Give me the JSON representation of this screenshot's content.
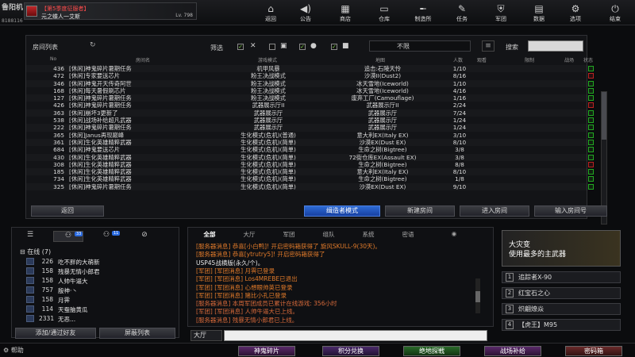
{
  "top": {
    "corner_logo": "鲁阳机",
    "user_id": "8188116",
    "season_badge": "【第5季度征服者】",
    "player_name": "元之蝶人一艾斯",
    "level": "Lv. 798",
    "nav": [
      "返回",
      "公告",
      "商店",
      "仓库",
      "制造所",
      "任务",
      "军团",
      "数据",
      "选项",
      "结束"
    ]
  },
  "room_list": {
    "title": "房间列表",
    "filter_label": "筛选",
    "mode_value": "不限",
    "search_label": "搜索",
    "search_value": "",
    "headers": [
      "No",
      "房间名",
      "游戏模式",
      "地图",
      "人数",
      "观看",
      "限制",
      "战场",
      "状态"
    ],
    "rows": [
      {
        "no": "436",
        "name": "[休闲]神鬼碎片暑期任务",
        "mode": "机甲风暴",
        "map": "追击:石陵天怜",
        "count": "1/10",
        "status": "green"
      },
      {
        "no": "472",
        "name": "[休闲]专家要送芯片",
        "mode": "粉王决战模式",
        "map": "沙漠II(Dust2)",
        "count": "8/16",
        "status": "red"
      },
      {
        "no": "346",
        "name": "[休闲]神鬼开天传奇阿世",
        "mode": "粉王决战模式",
        "map": "冰天雪地(Iceworld)",
        "count": "1/10",
        "status": "green"
      },
      {
        "no": "168",
        "name": "[休闲]每天暑假刷芯片",
        "mode": "粉王决战模式",
        "map": "冰天雪地(Iceworld)",
        "count": "4/16",
        "status": "green"
      },
      {
        "no": "127",
        "name": "[休闲]神鬼碎片暑期任务",
        "mode": "粉王决战模式",
        "map": "废弃工厂(Camouflage)",
        "count": "1/16",
        "status": "green"
      },
      {
        "no": "426",
        "name": "[休闲]神鬼碎片暑期任务",
        "mode": "武器展示厅II",
        "map": "武器展示厅II",
        "count": "2/24",
        "status": "red"
      },
      {
        "no": "363",
        "name": "[休闲]崩坏3更新了",
        "mode": "武器展示厅",
        "map": "武器展示厅",
        "count": "7/24",
        "status": "green"
      },
      {
        "no": "538",
        "name": "[休闲]战场补给超凡武器",
        "mode": "武器展示厅",
        "map": "武器展示厅",
        "count": "1/24",
        "status": "green"
      },
      {
        "no": "222",
        "name": "[休闲]神鬼碎片暑期任务",
        "mode": "武器展示厅",
        "map": "武器展示厅",
        "count": "1/24",
        "status": "green"
      },
      {
        "no": "365",
        "name": "[休闲]Janus再现巅峰",
        "mode": "生化模式(危机)(普通)",
        "map": "意大利EX(Italy EX)",
        "count": "3/10",
        "status": "green"
      },
      {
        "no": "361",
        "name": "[休闲]生化英雄精粹武器",
        "mode": "生化模式(危机)(简单)",
        "map": "沙漠EX(Dust EX)",
        "count": "8/10",
        "status": "green"
      },
      {
        "no": "684",
        "name": "[休闲]神鬼要送芯片",
        "mode": "生化模式(危机)(简单)",
        "map": "生命之树(Bigtree)",
        "count": "3/8",
        "status": "green"
      },
      {
        "no": "430",
        "name": "[休闲]生化英雄精粹武器",
        "mode": "生化模式(危机)(简单)",
        "map": "72街仓库EX(Assault EX)",
        "count": "3/8",
        "status": "green"
      },
      {
        "no": "308",
        "name": "[休闲]生化英雄精粹武器",
        "mode": "生化模式(危机)(简单)",
        "map": "生命之树(Bigtree)",
        "count": "8/8",
        "status": "red"
      },
      {
        "no": "185",
        "name": "[休闲]生化英雄精粹武器",
        "mode": "生化模式(危机)(简单)",
        "map": "意大利EX(Italy EX)",
        "count": "8/10",
        "status": "green"
      },
      {
        "no": "734",
        "name": "[休闲]生化英雄精粹武器",
        "mode": "生化模式(危机)(简单)",
        "map": "生命之树(Bigtree)",
        "count": "1/8",
        "status": "green"
      },
      {
        "no": "325",
        "name": "[休闲]神鬼碎片暑期任务",
        "mode": "生化模式(危机)(简单)",
        "map": "沙漠EX(Dust EX)",
        "count": "9/10",
        "status": "green"
      }
    ],
    "buttons": {
      "back": "返回",
      "hunter_mode": "缉造者模式",
      "create": "新建房间",
      "enter": "进入房间",
      "enter_number": "输入房间号"
    }
  },
  "friends": {
    "tab_badge_1": "33",
    "tab_badge_2": "11",
    "online_title": "在线 (7)",
    "list": [
      {
        "lv": "226",
        "name": "吃不胖的大萌新"
      },
      {
        "lv": "158",
        "name": "残暴无情小郎君"
      },
      {
        "lv": "158",
        "name": "人帅牛逼大"
      },
      {
        "lv": "757",
        "name": "殷神·丶"
      },
      {
        "lv": "158",
        "name": "月霁"
      },
      {
        "lv": "114",
        "name": "天蚕脑黄瓜"
      },
      {
        "lv": "2331",
        "name": "无恶..."
      }
    ],
    "add_button": "添加/通过好友",
    "block_button": "屏蔽列表"
  },
  "chat": {
    "tabs": [
      "全部",
      "大厅",
      "军团",
      "组队",
      "系统",
      "密语"
    ],
    "lines": [
      {
        "cls": "sys",
        "text": "[服务器消息] 恭喜[小白鸭]! 开启密码箱获得了 旋风SKULL-9(30天)。"
      },
      {
        "cls": "sys",
        "text": "[服务器消息] 恭喜[ytrutry5]! 开启密码箱获得了"
      },
      {
        "cls": "chat-white",
        "text": "USP45战横版(永久/个)。"
      },
      {
        "cls": "sys",
        "text": "[军团] [军团消息] 月霁已登录"
      },
      {
        "cls": "sys",
        "text": "[军团] [军团消息] Los4MREBE已退出"
      },
      {
        "cls": "sys",
        "text": "[军团] [军团消息] 心想眼帅英已登录"
      },
      {
        "cls": "sys",
        "text": "[军团] [军团消息] 赌比小孔已登录"
      },
      {
        "cls": "ann",
        "text": "[服务器消息] 本周军团成员已累计在线游戏: 356小时"
      },
      {
        "cls": "ann",
        "text": "[军团] [军团消息] 人帅牛逼大已上线。"
      },
      {
        "cls": "ann",
        "text": "[服务器消息] 残暴无情小郎君已上线。"
      }
    ],
    "channel": "大厅",
    "input_value": ""
  },
  "right": {
    "title": "大灾变",
    "subtitle": "使用最多的主武器",
    "weapons": [
      {
        "n": "1",
        "name": "追踪者X-90"
      },
      {
        "n": "2",
        "name": "红宝石之心"
      },
      {
        "n": "3",
        "name": "炽翩燎焱"
      },
      {
        "n": "4",
        "name": "【虎王】M95"
      }
    ]
  },
  "bottom": {
    "help": "帮助",
    "buttons": [
      "神鬼碎片",
      "积分兑换",
      "绝地探戦",
      "战场补给",
      "密码箱"
    ]
  }
}
